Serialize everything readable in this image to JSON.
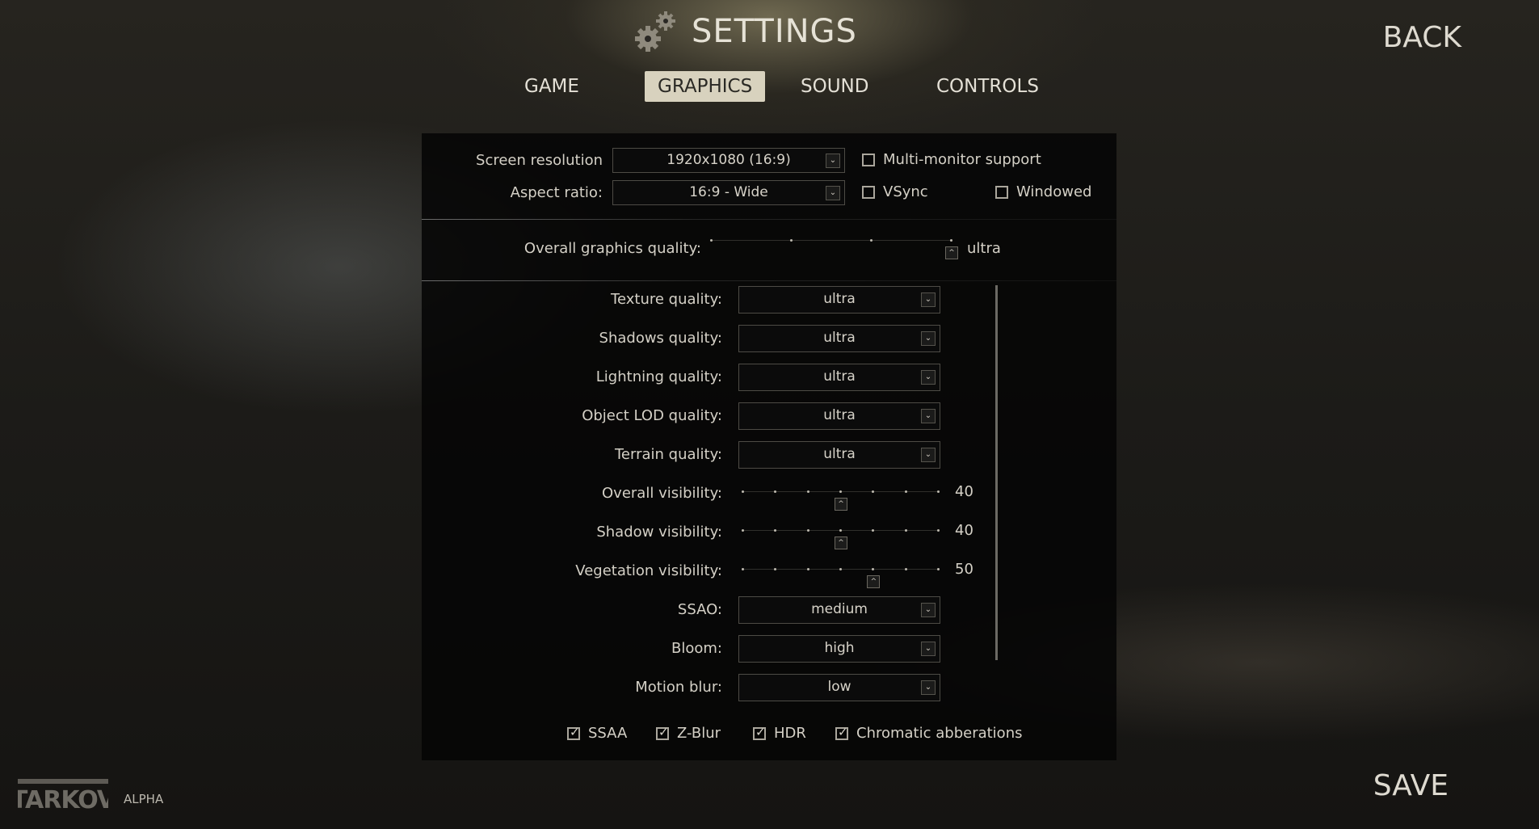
{
  "header": {
    "title": "SETTINGS",
    "back": "BACK",
    "save": "SAVE"
  },
  "tabs": [
    {
      "label": "GAME",
      "active": false
    },
    {
      "label": "GRAPHICS",
      "active": true
    },
    {
      "label": "SOUND",
      "active": false
    },
    {
      "label": "CONTROLS",
      "active": false
    }
  ],
  "display": {
    "screen_resolution": {
      "label": "Screen resolution",
      "value": "1920x1080 (16:9)"
    },
    "aspect_ratio": {
      "label": "Aspect ratio:",
      "value": "16:9 - Wide"
    },
    "multi_monitor": {
      "label": "Multi-monitor support",
      "checked": false
    },
    "vsync": {
      "label": "VSync",
      "checked": false
    },
    "windowed": {
      "label": "Windowed",
      "checked": false
    }
  },
  "overall_quality": {
    "label": "Overall graphics quality:",
    "value": "ultra",
    "level": 1.0
  },
  "quality_dropdowns": [
    {
      "label": "Texture quality:",
      "value": "ultra"
    },
    {
      "label": "Shadows quality:",
      "value": "ultra"
    },
    {
      "label": "Lightning quality:",
      "value": "ultra"
    },
    {
      "label": "Object LOD quality:",
      "value": "ultra"
    },
    {
      "label": "Terrain quality:",
      "value": "ultra"
    }
  ],
  "visibility_sliders": [
    {
      "label": "Overall visibility:",
      "value": "40",
      "level": 0.5
    },
    {
      "label": "Shadow visibility:",
      "value": "40",
      "level": 0.5
    },
    {
      "label": "Vegetation visibility:",
      "value": "50",
      "level": 0.667
    }
  ],
  "effect_dropdowns": [
    {
      "label": "SSAO:",
      "value": "medium"
    },
    {
      "label": "Bloom:",
      "value": "high"
    },
    {
      "label": "Motion blur:",
      "value": "low"
    }
  ],
  "toggles": [
    {
      "label": "SSAA",
      "checked": true
    },
    {
      "label": "Z-Blur",
      "checked": true
    },
    {
      "label": "HDR",
      "checked": true
    },
    {
      "label": "Chromatic abberations",
      "checked": true
    }
  ],
  "footer": {
    "logo_text": "ESCAPE FROM TARKOV",
    "badge": "ALPHA"
  }
}
